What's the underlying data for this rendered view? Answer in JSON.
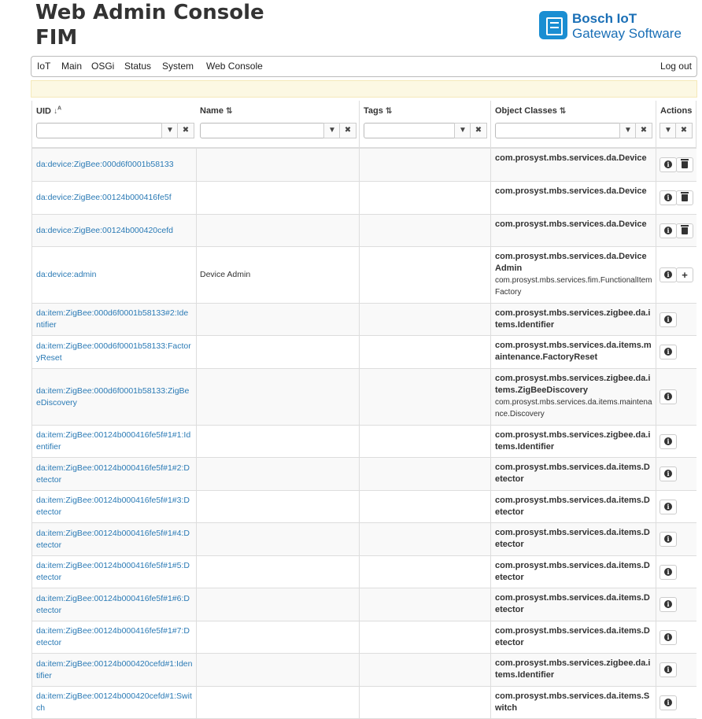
{
  "header": {
    "title_line1": "Web Admin Console",
    "title_line2": "FIM",
    "logo_line1": "Bosch IoT",
    "logo_line2": "Gateway Software"
  },
  "nav": {
    "items": [
      "IoT",
      "Main",
      "OSGi",
      "Status",
      "System",
      "Web Console"
    ],
    "logout": "Log out"
  },
  "table": {
    "columns": {
      "uid": "UID",
      "name": "Name",
      "tags": "Tags",
      "object_classes": "Object Classes",
      "actions": "Actions"
    },
    "rows": [
      {
        "uid": "da:device:ZigBee:000d6f0001b58133",
        "name": "",
        "tags": "",
        "oc_bold": "com.prosyst.mbs.services.da.Device",
        "oc_normal": "",
        "actions": [
          "info",
          "delete"
        ]
      },
      {
        "uid": "da:device:ZigBee:00124b000416fe5f",
        "name": "",
        "tags": "",
        "oc_bold": "com.prosyst.mbs.services.da.Device",
        "oc_normal": "",
        "actions": [
          "info",
          "delete"
        ]
      },
      {
        "uid": "da:device:ZigBee:00124b000420cefd",
        "name": "",
        "tags": "",
        "oc_bold": "com.prosyst.mbs.services.da.Device",
        "oc_normal": "",
        "actions": [
          "info",
          "delete"
        ]
      },
      {
        "uid": "da:device:admin",
        "name": "Device Admin",
        "tags": "",
        "oc_bold": "com.prosyst.mbs.services.da.DeviceAdmin",
        "oc_normal": "com.prosyst.mbs.services.fim.FunctionalItemFactory",
        "actions": [
          "info",
          "add"
        ]
      },
      {
        "uid": "da:item:ZigBee:000d6f0001b58133#2:Identifier",
        "name": "",
        "tags": "",
        "oc_bold": "com.prosyst.mbs.services.zigbee.da.items.Identifier",
        "oc_normal": "",
        "actions": [
          "info"
        ]
      },
      {
        "uid": "da:item:ZigBee:000d6f0001b58133:FactoryReset",
        "name": "",
        "tags": "",
        "oc_bold": "com.prosyst.mbs.services.da.items.maintenance.FactoryReset",
        "oc_normal": "",
        "actions": [
          "info"
        ]
      },
      {
        "uid": "da:item:ZigBee:000d6f0001b58133:ZigBeeDiscovery",
        "name": "",
        "tags": "",
        "oc_bold": "com.prosyst.mbs.services.zigbee.da.items.ZigBeeDiscovery",
        "oc_normal": "com.prosyst.mbs.services.da.items.maintenance.Discovery",
        "actions": [
          "info"
        ]
      },
      {
        "uid": "da:item:ZigBee:00124b000416fe5f#1#1:Identifier",
        "name": "",
        "tags": "",
        "oc_bold": "com.prosyst.mbs.services.zigbee.da.items.Identifier",
        "oc_normal": "",
        "actions": [
          "info"
        ]
      },
      {
        "uid": "da:item:ZigBee:00124b000416fe5f#1#2:Detector",
        "name": "",
        "tags": "",
        "oc_bold": "com.prosyst.mbs.services.da.items.Detector",
        "oc_normal": "",
        "actions": [
          "info"
        ]
      },
      {
        "uid": "da:item:ZigBee:00124b000416fe5f#1#3:Detector",
        "name": "",
        "tags": "",
        "oc_bold": "com.prosyst.mbs.services.da.items.Detector",
        "oc_normal": "",
        "actions": [
          "info"
        ]
      },
      {
        "uid": "da:item:ZigBee:00124b000416fe5f#1#4:Detector",
        "name": "",
        "tags": "",
        "oc_bold": "com.prosyst.mbs.services.da.items.Detector",
        "oc_normal": "",
        "actions": [
          "info"
        ]
      },
      {
        "uid": "da:item:ZigBee:00124b000416fe5f#1#5:Detector",
        "name": "",
        "tags": "",
        "oc_bold": "com.prosyst.mbs.services.da.items.Detector",
        "oc_normal": "",
        "actions": [
          "info"
        ]
      },
      {
        "uid": "da:item:ZigBee:00124b000416fe5f#1#6:Detector",
        "name": "",
        "tags": "",
        "oc_bold": "com.prosyst.mbs.services.da.items.Detector",
        "oc_normal": "",
        "actions": [
          "info"
        ]
      },
      {
        "uid": "da:item:ZigBee:00124b000416fe5f#1#7:Detector",
        "name": "",
        "tags": "",
        "oc_bold": "com.prosyst.mbs.services.da.items.Detector",
        "oc_normal": "",
        "actions": [
          "info"
        ]
      },
      {
        "uid": "da:item:ZigBee:00124b000420cefd#1:Identifier",
        "name": "",
        "tags": "",
        "oc_bold": "com.prosyst.mbs.services.zigbee.da.items.Identifier",
        "oc_normal": "",
        "actions": [
          "info"
        ]
      },
      {
        "uid": "da:item:ZigBee:00124b000420cefd#1:Switch",
        "name": "",
        "tags": "",
        "oc_bold": "com.prosyst.mbs.services.da.items.Switch",
        "oc_normal": "",
        "actions": [
          "info"
        ]
      }
    ]
  }
}
